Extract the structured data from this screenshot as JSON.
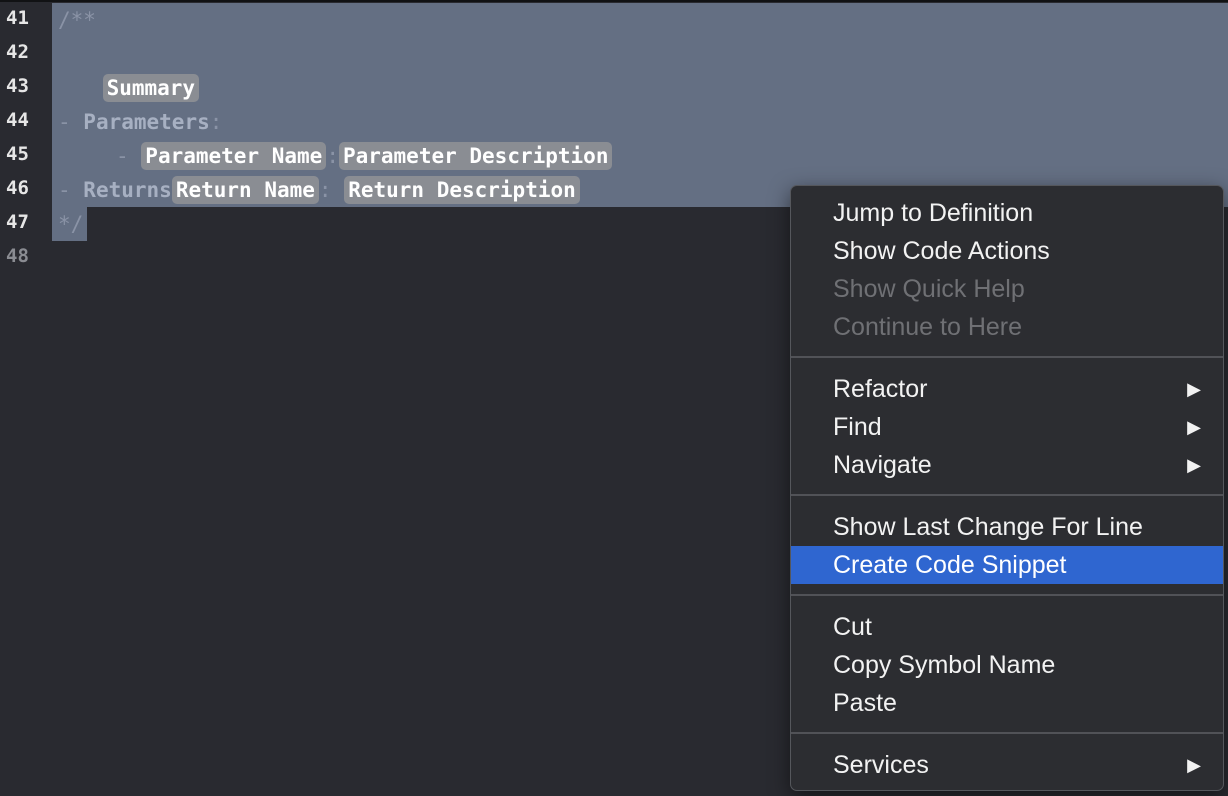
{
  "editor": {
    "line_numbers": [
      "41",
      "42",
      "43",
      "44",
      "45",
      "46",
      "47",
      "48"
    ],
    "lines": {
      "l41": "/**",
      "l42_placeholder": "Summary",
      "l44_dash": "- ",
      "l44_keyword": "Parameters",
      "l44_colon": ":",
      "l45_dash": "- ",
      "l45_param_name": "Parameter Name",
      "l45_colon": ":",
      "l45_param_desc": "Parameter Description",
      "l46_dash": "- ",
      "l46_keyword": "Returns",
      "l46_return_name": "Return Name",
      "l46_colon": ": ",
      "l46_return_desc": "Return Description",
      "l47": "*/"
    }
  },
  "context_menu": {
    "group1": {
      "jump_to_definition": "Jump to Definition",
      "show_code_actions": "Show Code Actions",
      "show_quick_help": "Show Quick Help",
      "continue_to_here": "Continue to Here"
    },
    "group2": {
      "refactor": "Refactor",
      "find": "Find",
      "navigate": "Navigate"
    },
    "group3": {
      "show_last_change": "Show Last Change For Line",
      "create_code_snippet": "Create Code Snippet"
    },
    "group4": {
      "cut": "Cut",
      "copy_symbol_name": "Copy Symbol Name",
      "paste": "Paste"
    },
    "group5": {
      "services": "Services"
    },
    "submenu_arrow": "▶"
  },
  "colors": {
    "editor_background": "#292a30",
    "selection": "#646f83",
    "menu_background": "#2c2d31",
    "menu_highlight": "#2f66d0",
    "placeholder_token": "#8a8d93"
  }
}
